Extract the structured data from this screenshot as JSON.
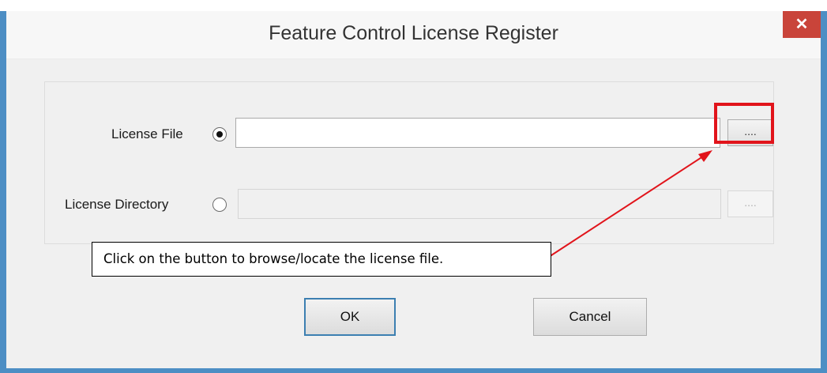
{
  "window": {
    "title": "Feature Control License Register",
    "close_glyph": "✕"
  },
  "form": {
    "license_file": {
      "label": "License File",
      "selected": true,
      "value": "",
      "browse_label": "...."
    },
    "license_directory": {
      "label": "License Directory",
      "selected": false,
      "value": "",
      "browse_label": "....",
      "enabled": false
    }
  },
  "buttons": {
    "ok_label": "OK",
    "cancel_label": "Cancel"
  },
  "annotation": {
    "callout_text": "Click on the button to browse/locate the license file.",
    "highlight_color": "#e1141b"
  },
  "colors": {
    "window_frame": "#4d8ec4",
    "close_button": "#c9443a"
  }
}
